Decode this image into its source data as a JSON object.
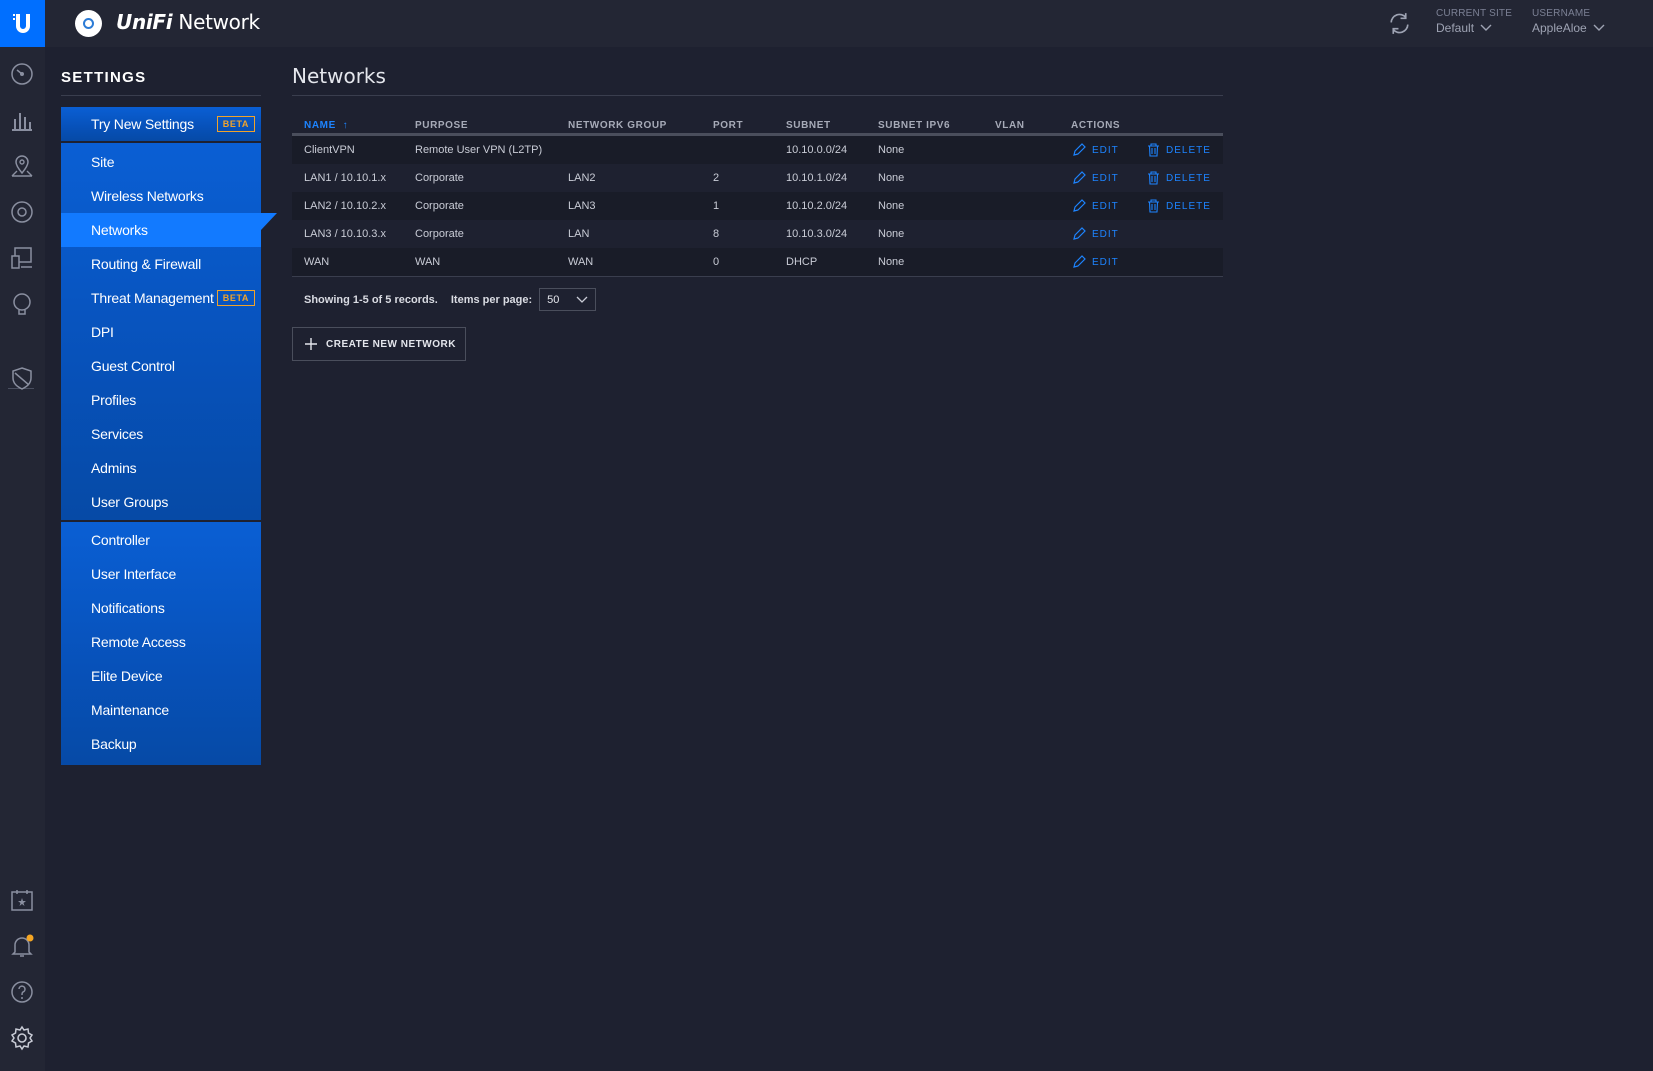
{
  "app": {
    "name_brand": "UniFi",
    "name_product": "Network"
  },
  "header": {
    "current_site_caption": "CURRENT SITE",
    "current_site_value": "Default",
    "username_caption": "USERNAME",
    "username_value": "AppleAloe"
  },
  "rail": {
    "icons": [
      "dashboard-icon",
      "statistics-icon",
      "map-icon",
      "devices-icon",
      "clients-icon",
      "insights-icon",
      "threat-shield-icon",
      "events-calendar-icon",
      "alerts-bell-icon",
      "help-icon",
      "settings-gear-icon"
    ],
    "alert_dot_color": "#f5a623"
  },
  "settings": {
    "title": "SETTINGS",
    "try_new": {
      "label": "Try New Settings",
      "badge": "BETA"
    },
    "site_group": [
      {
        "label": "Site"
      },
      {
        "label": "Wireless Networks"
      },
      {
        "label": "Networks"
      },
      {
        "label": "Routing & Firewall"
      },
      {
        "label": "Threat Management",
        "badge": "BETA"
      },
      {
        "label": "DPI"
      },
      {
        "label": "Guest Control"
      },
      {
        "label": "Profiles"
      },
      {
        "label": "Services"
      },
      {
        "label": "Admins"
      },
      {
        "label": "User Groups"
      }
    ],
    "controller_group": [
      {
        "label": "Controller"
      },
      {
        "label": "User Interface"
      },
      {
        "label": "Notifications"
      },
      {
        "label": "Remote Access"
      },
      {
        "label": "Elite Device"
      },
      {
        "label": "Maintenance"
      },
      {
        "label": "Backup"
      }
    ],
    "active": "Networks"
  },
  "main": {
    "title": "Networks",
    "columns": {
      "name": "NAME",
      "purpose": "PURPOSE",
      "network_group": "NETWORK GROUP",
      "port": "PORT",
      "subnet": "SUBNET",
      "subnet_ipv6": "SUBNET IPV6",
      "vlan": "VLAN",
      "actions": "ACTIONS"
    },
    "sort_indicator": "↑",
    "rows": [
      {
        "name": "ClientVPN",
        "purpose": "Remote User VPN (L2TP)",
        "network_group": "",
        "port": "",
        "subnet": "10.10.0.0/24",
        "subnet_ipv6": "None",
        "vlan": "",
        "edit": "EDIT",
        "delete": "DELETE"
      },
      {
        "name": "LAN1 / 10.10.1.x",
        "purpose": "Corporate",
        "network_group": "LAN2",
        "port": "2",
        "subnet": "10.10.1.0/24",
        "subnet_ipv6": "None",
        "vlan": "",
        "edit": "EDIT",
        "delete": "DELETE"
      },
      {
        "name": "LAN2 / 10.10.2.x",
        "purpose": "Corporate",
        "network_group": "LAN3",
        "port": "1",
        "subnet": "10.10.2.0/24",
        "subnet_ipv6": "None",
        "vlan": "",
        "edit": "EDIT",
        "delete": "DELETE"
      },
      {
        "name": "LAN3 / 10.10.3.x",
        "purpose": "Corporate",
        "network_group": "LAN",
        "port": "8",
        "subnet": "10.10.3.0/24",
        "subnet_ipv6": "None",
        "vlan": "",
        "edit": "EDIT",
        "delete": ""
      },
      {
        "name": "WAN",
        "purpose": "WAN",
        "network_group": "WAN",
        "port": "0",
        "subnet": "DHCP",
        "subnet_ipv6": "None",
        "vlan": "",
        "edit": "EDIT",
        "delete": ""
      }
    ],
    "pager": {
      "records_text": "Showing 1-5 of 5 records.",
      "per_page_label": "Items per page:",
      "per_page_value": "50"
    },
    "create_button": "CREATE NEW NETWORK"
  },
  "colors": {
    "accent": "#127aff",
    "link": "#1d84ff",
    "badge": "#f0a32b",
    "background": "#1e2130",
    "bar": "#232634"
  }
}
